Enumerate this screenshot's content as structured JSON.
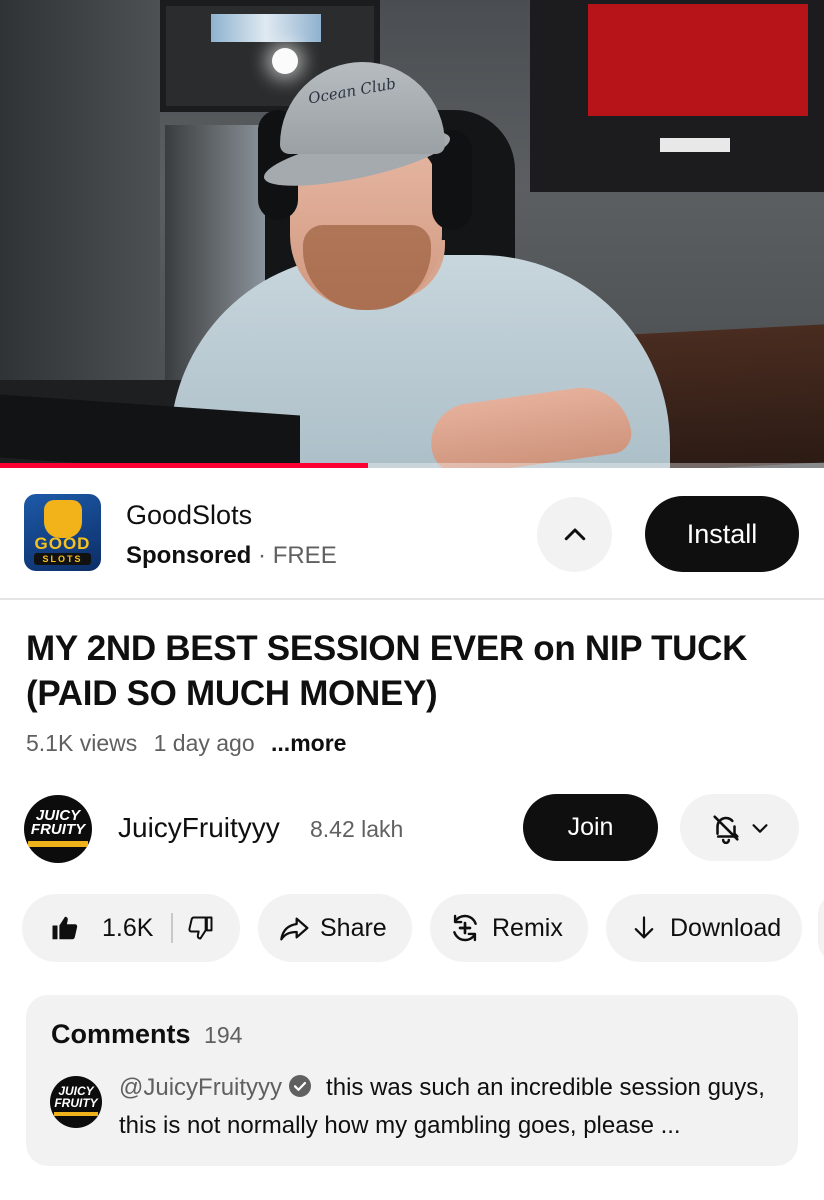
{
  "player": {
    "progress_fraction": 0.447,
    "cap_text": "Ocean Club",
    "colors": {
      "progress": "#ff0033"
    }
  },
  "ad": {
    "icon_text_top": "GOOD",
    "icon_text_bottom": "SLOTS",
    "app_name": "GoodSlots",
    "sponsored_label": "Sponsored",
    "separator": "·",
    "price": "FREE",
    "collapse_icon": "chevron-up-icon",
    "install_label": "Install"
  },
  "video": {
    "title": "MY 2ND BEST SESSION EVER on NIP TUCK (PAID SO MUCH MONEY)",
    "views": "5.1K views",
    "age": "1 day ago",
    "more_label": "...more"
  },
  "channel": {
    "avatar_text": "JUICY FRUITY",
    "name": "JuicyFruityyy",
    "subscribers": "8.42 lakh",
    "join_label": "Join",
    "notification_icon": "bell-off-icon"
  },
  "actions": {
    "like_count": "1.6K",
    "share_label": "Share",
    "remix_label": "Remix",
    "download_label": "Download"
  },
  "comments": {
    "heading": "Comments",
    "count": "194",
    "top_comment": {
      "avatar_text": "JUICY FRUITY",
      "author": "@JuicyFruityyy",
      "text": "this was such an incredible session guys, this is not normally how my gambling goes, please ..."
    }
  }
}
